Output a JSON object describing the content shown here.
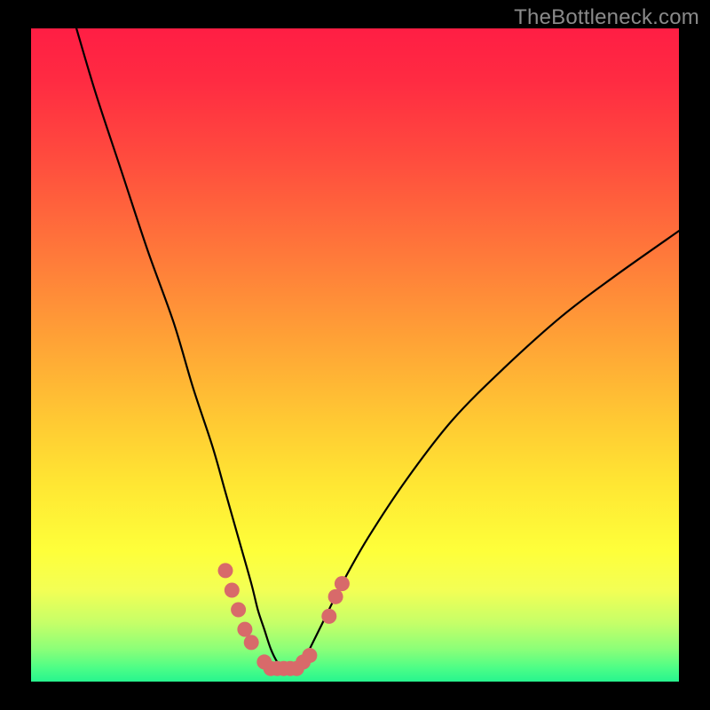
{
  "watermark": "TheBottleneck.com",
  "colors": {
    "background": "#000000",
    "curve_stroke": "#000000",
    "marker_fill": "#d86a6a",
    "gradient_stops": [
      "#ff1e44",
      "#ff4c3e",
      "#ffa336",
      "#ffe733",
      "#feff3a",
      "#8cff78",
      "#27f58e"
    ]
  },
  "chart_data": {
    "type": "line",
    "title": "",
    "xlabel": "",
    "ylabel": "",
    "xlim": [
      0,
      100
    ],
    "ylim": [
      0,
      100
    ],
    "grid": false,
    "legend": false,
    "series": [
      {
        "name": "bottleneck-curve",
        "x": [
          7,
          10,
          14,
          18,
          22,
          25,
          28,
          30,
          32,
          34,
          35,
          36,
          37,
          38,
          39,
          40,
          41,
          42,
          43,
          45,
          48,
          52,
          58,
          65,
          73,
          82,
          90,
          100
        ],
        "y": [
          100,
          90,
          78,
          66,
          55,
          45,
          36,
          29,
          22,
          15,
          11,
          8,
          5,
          3,
          2,
          2,
          2,
          3,
          5,
          9,
          15,
          22,
          31,
          40,
          48,
          56,
          62,
          69
        ]
      }
    ],
    "markers": [
      {
        "x": 30,
        "y": 17
      },
      {
        "x": 31,
        "y": 14
      },
      {
        "x": 32,
        "y": 11
      },
      {
        "x": 33,
        "y": 8
      },
      {
        "x": 34,
        "y": 6
      },
      {
        "x": 36,
        "y": 3
      },
      {
        "x": 37,
        "y": 2
      },
      {
        "x": 38,
        "y": 2
      },
      {
        "x": 39,
        "y": 2
      },
      {
        "x": 40,
        "y": 2
      },
      {
        "x": 41,
        "y": 2
      },
      {
        "x": 42,
        "y": 3
      },
      {
        "x": 43,
        "y": 4
      },
      {
        "x": 46,
        "y": 10
      },
      {
        "x": 47,
        "y": 13
      },
      {
        "x": 48,
        "y": 15
      }
    ]
  }
}
